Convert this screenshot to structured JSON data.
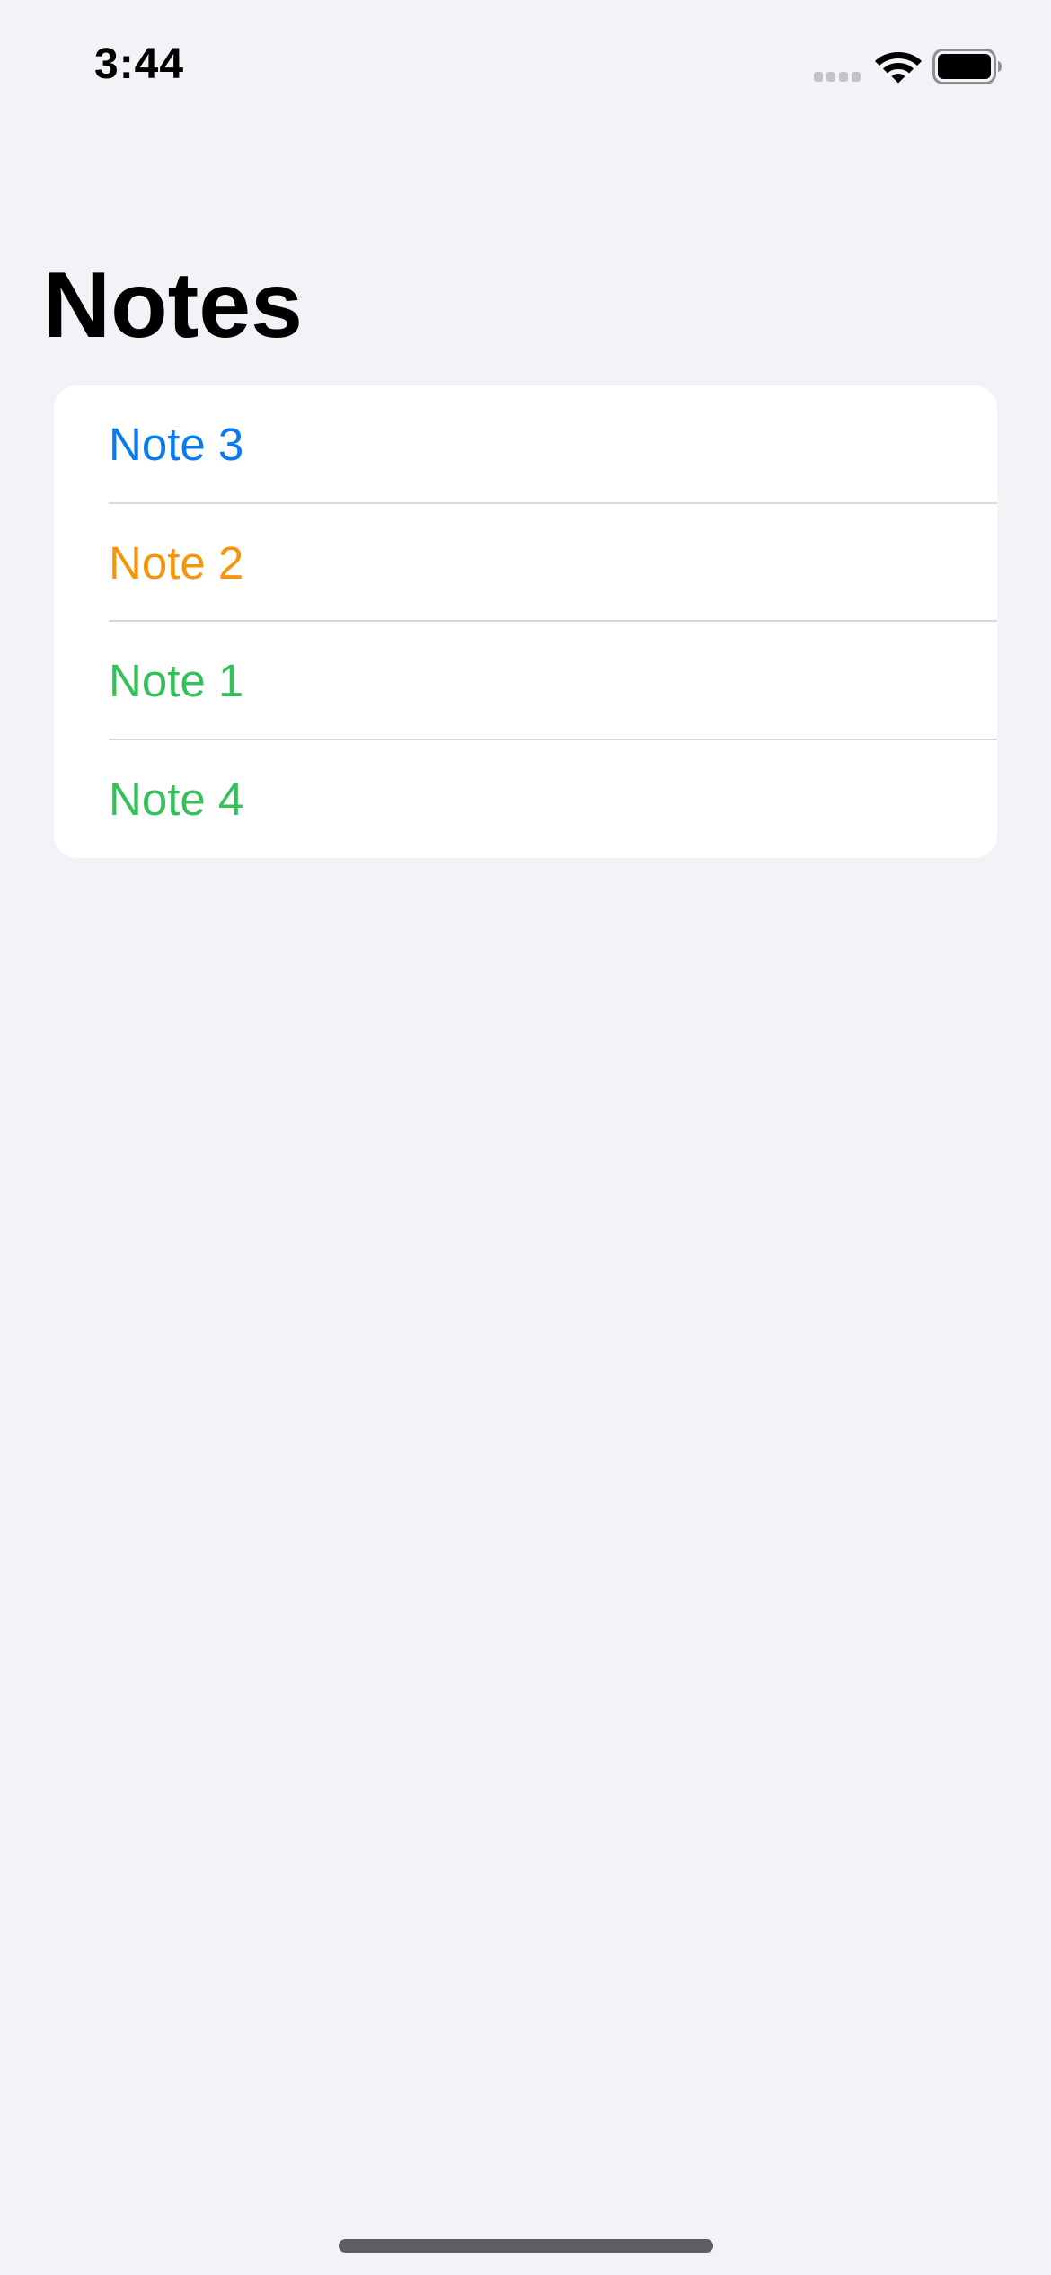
{
  "status_bar": {
    "time": "3:44",
    "cellular_icon": "cellular-signal-icon",
    "wifi_icon": "wifi-icon",
    "battery_icon": "battery-icon",
    "battery_level": 1.0
  },
  "title": "Notes",
  "notes": [
    {
      "label": "Note 3",
      "color": "#0A7AF0"
    },
    {
      "label": "Note 2",
      "color": "#F7950A"
    },
    {
      "label": "Note 1",
      "color": "#34C159"
    },
    {
      "label": "Note 4",
      "color": "#34C159"
    }
  ],
  "colors": {
    "background": "#F2F2F7",
    "list_background": "#FFFFFF",
    "separator": "#D8D8DC"
  }
}
